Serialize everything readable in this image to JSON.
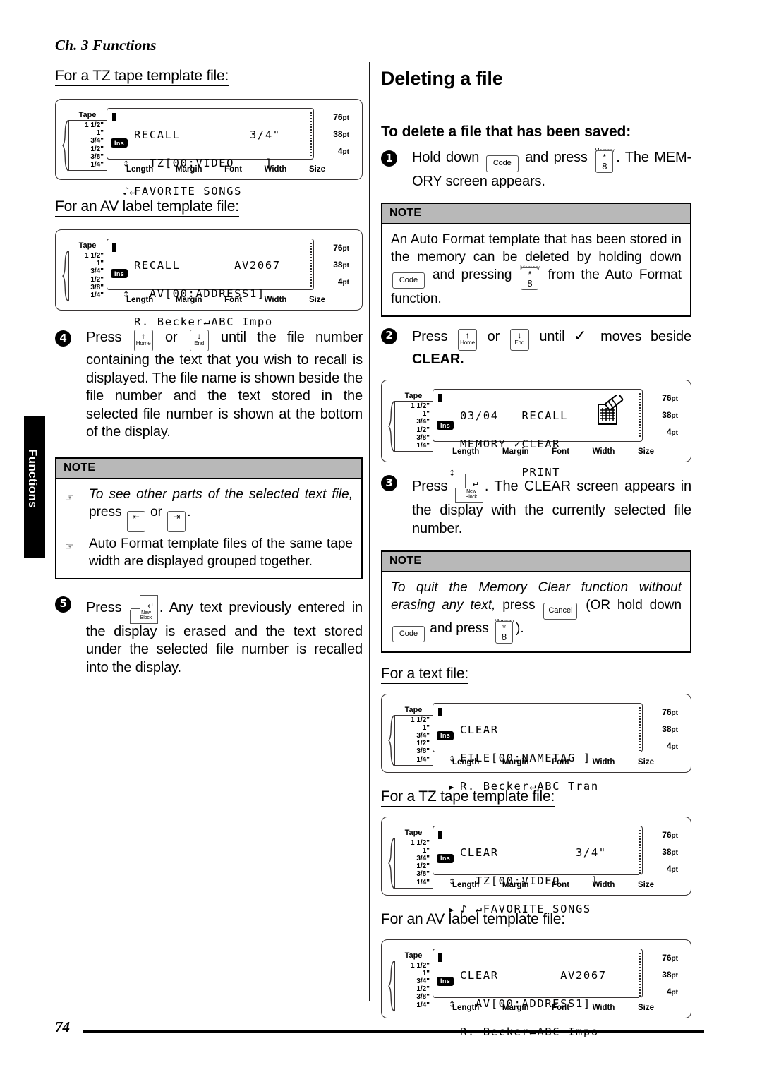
{
  "chapter": "Ch. 3 Functions",
  "side_tab": "Functions",
  "page_number": "74",
  "left_column": {
    "head_tz": "For a TZ tape template file:",
    "head_av": "For an AV label template file:",
    "lcd_tz": {
      "tape_title": "Tape",
      "tape_widths": [
        "1 1/2\"",
        "1\"",
        "3/4\"",
        "1/2\"",
        "3/8\"",
        "1/4\""
      ],
      "ins": "Ins",
      "line1": "RECALL         3/4\"",
      "line2": "  TZ[00:VIDEO    ]",
      "line2_indicator": "↕",
      "line3": "FAVORITE SONGS",
      "line3_indicator": "♪↵",
      "pt_values": [
        "76",
        "38",
        "4"
      ],
      "pt_unit": "pt",
      "bottom_labels": [
        "Length",
        "Margin",
        "Font",
        "Width",
        "Size"
      ]
    },
    "lcd_av": {
      "tape_title": "Tape",
      "tape_widths": [
        "1 1/2\"",
        "1\"",
        "3/4\"",
        "1/2\"",
        "3/8\"",
        "1/4\""
      ],
      "ins": "Ins",
      "line1": "RECALL       AV2067",
      "line2": "  AV[00:ADDRESS1]",
      "line2_indicator": "↕",
      "line3": "R. Becker↵ABC Impo",
      "line3_indicator": "",
      "pt_values": [
        "76",
        "38",
        "4"
      ],
      "pt_unit": "pt",
      "bottom_labels": [
        "Length",
        "Margin",
        "Font",
        "Width",
        "Size"
      ]
    },
    "step4": {
      "number": "4",
      "text_a": "Press",
      "key_home": {
        "label": "Home",
        "arrow": "↑"
      },
      "text_b": "or",
      "key_end": {
        "label": "End",
        "arrow": "↓"
      },
      "text_c": "until the file number containing the text that you wish to recall is displayed. The file name is shown beside the file number and the text stored in the selected file number is shown at the bottom of the display."
    },
    "note": {
      "title": "NOTE",
      "item1_a": "To see other parts of the selected text file,",
      "item1_b": "press",
      "item1_or": "or",
      "item1_end": ".",
      "item2": "Auto Format template files of the same tape width are displayed grouped together."
    },
    "step5": {
      "number": "5",
      "text_a": "Press",
      "key_newblock": {
        "label_line1": "New",
        "label_line2": "Block",
        "arrow": "↵"
      },
      "text_b": ". Any text previously entered in the display is erased and the text stored under the selected file number is recalled into the display."
    }
  },
  "right_column": {
    "title": "Deleting a file",
    "subtitle": "To delete a file that has been saved:",
    "step1": {
      "number": "1",
      "text_a": "Hold down",
      "key_code": "Code",
      "text_b": "and press",
      "key_memory": {
        "top_label": "Memory",
        "line1": "*",
        "line2": "8"
      },
      "text_c": ". The MEM-ORY screen appears."
    },
    "note1": {
      "title": "NOTE",
      "text_a": "An Auto Format template that has been stored in the memory can be deleted by holding down",
      "key_code": "Code",
      "text_b": "and pressing",
      "key_memory": {
        "top_label": "Memory",
        "line1": "*",
        "line2": "8"
      },
      "text_c": "from the Auto Format function."
    },
    "step2": {
      "number": "2",
      "text_a": "Press",
      "key_home": {
        "label": "Home",
        "arrow": "↑"
      },
      "text_b": "or",
      "key_end": {
        "label": "End",
        "arrow": "↓"
      },
      "text_c": "until",
      "check": "✓",
      "text_d": "moves beside",
      "text_bold": "CLEAR."
    },
    "lcd_memory": {
      "tape_title": "Tape",
      "tape_widths": [
        "1 1/2\"",
        "1\"",
        "3/4\"",
        "1/2\"",
        "3/8\"",
        "1/4\""
      ],
      "ins": "Ins",
      "line1": "03/04   RECALL",
      "line2": "MEMORY ✓CLEAR",
      "line3": "        PRINT",
      "line3_indicator": "↕",
      "printer_icon": "printer-icon",
      "pt_values": [
        "76",
        "38",
        "4"
      ],
      "pt_unit": "pt",
      "bottom_labels": [
        "Length",
        "Margin",
        "Font",
        "Width",
        "Size"
      ]
    },
    "step3": {
      "number": "3",
      "text_a": "Press",
      "key_newblock": {
        "label_line1": "New",
        "label_line2": "Block",
        "arrow": "↵"
      },
      "text_b": ". The CLEAR screen appears in the display with the currently selected file number."
    },
    "note2": {
      "title": "NOTE",
      "text_a": "To quit the Memory Clear function without erasing any text,",
      "text_b": "press",
      "key_cancel": "Cancel",
      "text_c": "(OR hold down",
      "key_code": "Code",
      "text_d": "and press",
      "key_memory": {
        "top_label": "Memory",
        "line1": "*",
        "line2": "8"
      },
      "text_e": ")."
    },
    "head_text": "For a text file:",
    "lcd_text": {
      "tape_title": "Tape",
      "tape_widths": [
        "1 1/2\"",
        "1\"",
        "3/4\"",
        "1/2\"",
        "3/8\"",
        "1/4\""
      ],
      "ins": "Ins",
      "line1": "CLEAR",
      "line2": "FILE[00:NAMETAG ]",
      "line2_indicator": "↕",
      "line3": "R. Becker↵ABC Tran",
      "line3_indicator": "▶",
      "pt_values": [
        "76",
        "38",
        "4"
      ],
      "pt_unit": "pt",
      "bottom_labels": [
        "Length",
        "Margin",
        "Font",
        "Width",
        "Size"
      ]
    },
    "head_tz": "For a TZ tape template file:",
    "lcd_tz": {
      "tape_title": "Tape",
      "tape_widths": [
        "1 1/2\"",
        "1\"",
        "3/4\"",
        "1/2\"",
        "3/8\"",
        "1/4\""
      ],
      "ins": "Ins",
      "line1": "CLEAR          3/4\"",
      "line2": "  TZ[00:VIDEO    ]",
      "line2_indicator": "↕",
      "line3": "♪ ↵FAVORITE SONGS",
      "line3_indicator": "▶",
      "pt_values": [
        "76",
        "38",
        "4"
      ],
      "pt_unit": "pt",
      "bottom_labels": [
        "Length",
        "Margin",
        "Font",
        "Width",
        "Size"
      ]
    },
    "head_av": "For an AV label template file:",
    "lcd_av": {
      "tape_title": "Tape",
      "tape_widths": [
        "1 1/2\"",
        "1\"",
        "3/4\"",
        "1/2\"",
        "3/8\"",
        "1/4\""
      ],
      "ins": "Ins",
      "line1": "CLEAR        AV2067",
      "line2": "  AV[00:ADDRESS1]",
      "line2_indicator": "↕",
      "line3": "R. Becker↵ABC Impo",
      "line3_indicator": "",
      "pt_values": [
        "76",
        "38",
        "4"
      ],
      "pt_unit": "pt",
      "bottom_labels": [
        "Length",
        "Margin",
        "Font",
        "Width",
        "Size"
      ]
    }
  }
}
